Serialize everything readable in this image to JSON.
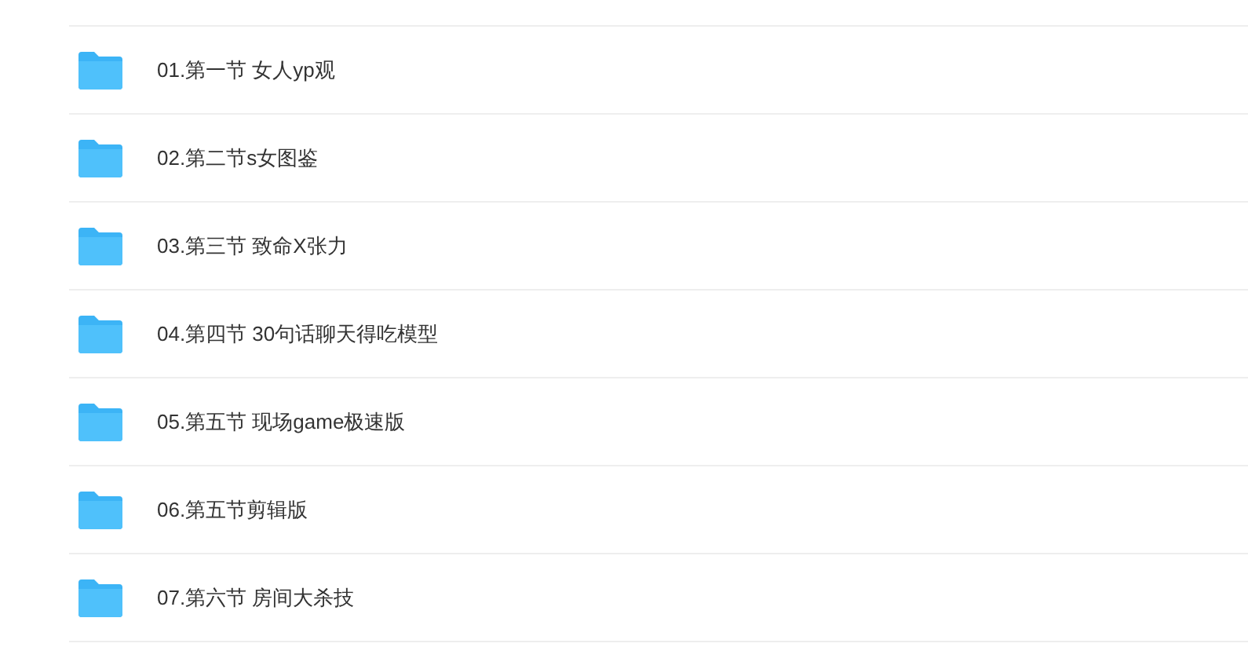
{
  "folders": [
    {
      "name": "01.第一节 女人yp观"
    },
    {
      "name": "02.第二节s女图鉴"
    },
    {
      "name": "03.第三节 致命X张力"
    },
    {
      "name": "04.第四节 30句话聊天得吃模型"
    },
    {
      "name": "05.第五节 现场game极速版"
    },
    {
      "name": "06.第五节剪辑版"
    },
    {
      "name": "07.第六节 房间大杀技"
    }
  ]
}
